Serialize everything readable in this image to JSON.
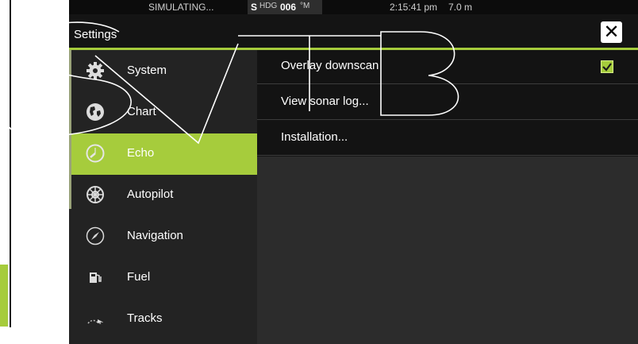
{
  "status_bar": {
    "simulating": "SIMULATING...",
    "heading_indicator": "S",
    "heading_label": "HDG",
    "heading_value": "006",
    "heading_unit": "°M",
    "time": "2:15:41 pm",
    "depth": "7.0 m"
  },
  "dialog": {
    "title": "Settings",
    "close_label": "✕"
  },
  "sidebar": {
    "items": [
      {
        "label": "System",
        "icon": "gear-icon",
        "active": false
      },
      {
        "label": "Chart",
        "icon": "globe-icon",
        "active": false
      },
      {
        "label": "Echo",
        "icon": "echo-icon",
        "active": true
      },
      {
        "label": "Autopilot",
        "icon": "helm-icon",
        "active": false
      },
      {
        "label": "Navigation",
        "icon": "compass-icon",
        "active": false
      },
      {
        "label": "Fuel",
        "icon": "fuel-pump-icon",
        "active": false
      },
      {
        "label": "Tracks",
        "icon": "track-icon",
        "active": false
      }
    ]
  },
  "options": {
    "overlay_downscan": {
      "label": "Overlay downscan",
      "checked": true
    },
    "view_sonar_log": {
      "label": "View sonar log..."
    },
    "installation": {
      "label": "Installation..."
    }
  },
  "watermark": {
    "text": "SVTB"
  },
  "colors": {
    "accent": "#a6cc3c",
    "background": "#171717",
    "sidebar": "#232323",
    "content": "#2c2c2c"
  }
}
